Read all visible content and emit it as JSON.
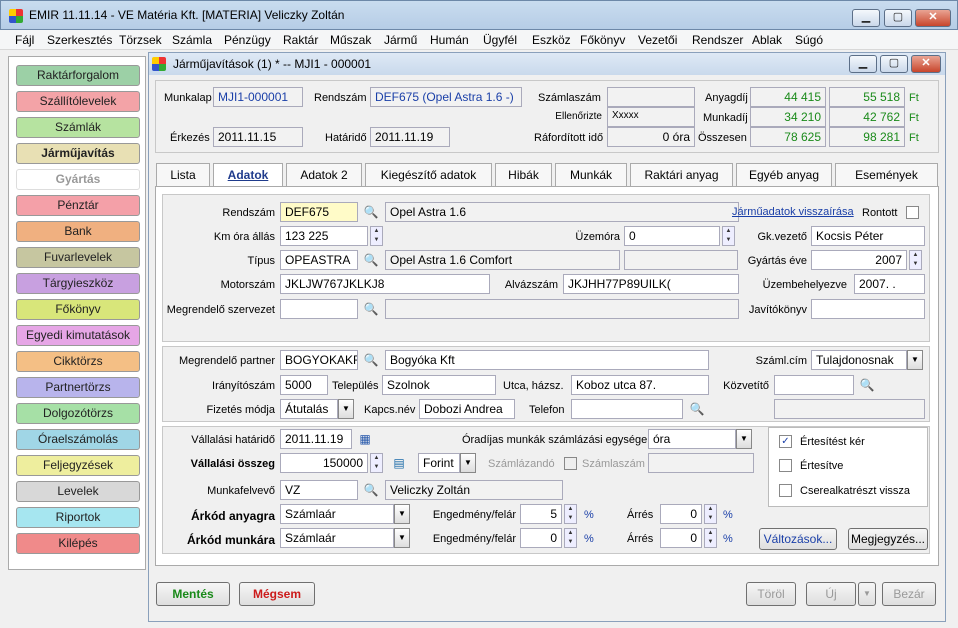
{
  "window": {
    "title": "EMIR 11.11.14 - VE Matéria Kft. [MATERIA] Veliczky Zoltán",
    "min": "▁",
    "max": "▢",
    "close": "✕"
  },
  "menu": [
    "Fájl",
    "Szerkesztés",
    "Törzsek",
    "Számla",
    "Pénzügy",
    "Raktár",
    "Műszak",
    "Jármű",
    "Humán",
    "Ügyfél",
    "Eszköz",
    "Főkönyv",
    "Vezetői",
    "Rendszer",
    "Ablak",
    "Súgó"
  ],
  "sidebar": [
    "Raktárforgalom",
    "Szállítólevelek",
    "Számlák",
    "Járműjavítás",
    "Gyártás",
    "Pénztár",
    "Bank",
    "Fuvarlevelek",
    "Tárgyieszköz",
    "Főkönyv",
    "Egyedi kimutatások",
    "Cikktörzs",
    "Partnertörzs",
    "Dolgozótörzs",
    "Óraelszámolás",
    "Feljegyzések",
    "Levelek",
    "Riportok",
    "Kilépés"
  ],
  "sidebar_colors": [
    "#9cd0a6",
    "#f3a3a7",
    "#b6e3a0",
    "#e8e0b4",
    "#ffffff",
    "#f4a0a8",
    "#f0b080",
    "#c6c6a0",
    "#c8a0e0",
    "#d8e67a",
    "#e6a6e6",
    "#f4bf85",
    "#b8b4ec",
    "#a6e0a6",
    "#a0d6e6",
    "#eeee9e",
    "#d8d8d8",
    "#a6e6f0",
    "#f08a8a"
  ],
  "doc": {
    "title": "Járműjavítások (1) * -- MJI1 - 000001"
  },
  "header": {
    "munkalap_label": "Munkalap",
    "munkalap": "MJI1-000001",
    "rendszam_label": "Rendszám",
    "rendszam": "DEF675 (Opel Astra 1.6 -)",
    "szamlaszam_label": "Számlaszám",
    "szamlaszam": "",
    "ellenorizte_label": "Ellenőrizte",
    "ellenorizte": "Xxxxx",
    "erkezes_label": "Érkezés",
    "erkezes": "2011.11.15",
    "hatarido_label": "Határidő",
    "hatarido": "2011.11.19",
    "raforditott_label": "Ráfordított idő",
    "raforditott": "0 óra",
    "anyagdij_label": "Anyagdíj",
    "anyagdij_1": "44 415",
    "anyagdij_2": "55 518",
    "munkadij_label": "Munkadíj",
    "munkadij_1": "34 210",
    "munkadij_2": "42 762",
    "osszesen_label": "Összesen",
    "osszesen_1": "78 625",
    "osszesen_2": "98 281",
    "currency": "Ft"
  },
  "tabs": [
    "Lista",
    "Adatok",
    "Adatok 2",
    "Kiegészítő adatok",
    "Hibák",
    "Munkák",
    "Raktári anyag",
    "Egyéb anyag",
    "Események"
  ],
  "form": {
    "rendszam_label": "Rendszám",
    "rendszam": "DEF675",
    "rendszam_desc": "Opel Astra 1.6",
    "jarmuadatok_link": "Járműadatok visszaírása",
    "rontott_label": "Rontott",
    "kmora_label": "Km óra állás",
    "kmora": "123 225",
    "uzemora_label": "Üzemóra",
    "uzemora": "0",
    "gkvezeto_label": "Gk.vezető",
    "gkvezeto": "Kocsis Péter",
    "tipus_label": "Típus",
    "tipus": "OPEASTRA",
    "tipus_desc": "Opel Astra 1.6 Comfort",
    "gyartasev_label": "Gyártás éve",
    "gyartasev": "2007",
    "motorszam_label": "Motorszám",
    "motorszam": "JKLJW767JKLKJ8",
    "alvazszam_label": "Alvázszám",
    "alvazszam": "JKJHH77P89UILK(",
    "uzembe_label": "Üzembehelyezve",
    "uzembe": "2007.  .",
    "megrendelo_szerv_label": "Megrendelő szervezet",
    "javitokonyv_label": "Javítókönyv",
    "partner_label": "Megrendelő partner",
    "partner": "BOGYOKAKF",
    "partner_name": "Bogyóka Kft",
    "szamlacim_label": "Száml.cím",
    "szamlacim": "Tulajdonosnak",
    "irsz_label": "Irányítószám",
    "irsz": "5000",
    "telepules_label": "Település",
    "telepules": "Szolnok",
    "utca_label": "Utca, házsz.",
    "utca": "Koboz utca 87.",
    "kozvetito_label": "Közvetítő",
    "fizmod_label": "Fizetés módja",
    "fizmod": "Átutalás",
    "kapcs_label": "Kapcs.név",
    "kapcs": "Dobozi Andrea",
    "telefon_label": "Telefon",
    "vhatarido_label": "Vállalási határidő",
    "vhatarido": "2011.11.19",
    "oradij_label": "Óradíjas munkák számlázási egysége",
    "oradij": "óra",
    "vosszeg_label": "Vállalási összeg",
    "vosszeg": "150000",
    "penznem": "Forint",
    "szamlazando_label": "Számlázandó",
    "szamlaszam2_label": "Számlaszám",
    "munkafelvevo_label": "Munkafelvevő",
    "munkafelvevo": "VZ",
    "munkafelvevo_name": "Veliczky Zoltán",
    "arkod_anyag_label": "Árkód anyagra",
    "arkod_anyag": "Számlaár",
    "arkod_munka_label": "Árkód munkára",
    "arkod_munka": "Számlaár",
    "engedmeny_label": "Engedmény/felár",
    "engedmeny1": "5",
    "engedmeny2": "0",
    "arres_label": "Árrés",
    "arres1": "0",
    "arres2": "0",
    "pct": "%",
    "ertesitest_label": "Értesítést kér",
    "ertesitve_label": "Értesítve",
    "csere_label": "Cserealkatrészt vissza",
    "valtozasok_btn": "Változások...",
    "megjegyzes_btn": "Megjegyzés..."
  },
  "footer": {
    "save": "Mentés",
    "cancel": "Mégsem",
    "delete": "Töröl",
    "new": "Új",
    "close": "Bezár"
  }
}
